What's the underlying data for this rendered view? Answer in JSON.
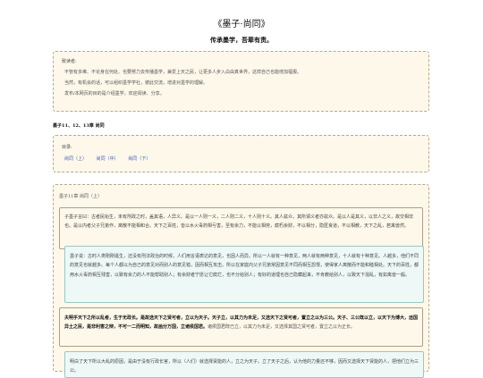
{
  "header": {
    "title": "《墨子·尚同》",
    "motto": "传承墨学，吾辈有责。"
  },
  "intro": {
    "greeting": "致读者:",
    "lines": [
      "不管有多难、不论身在何处、也要努力去传播墨学，兼爱上天之民，让更多人步入白由真世界，这样自己也能增加福报。",
      "当然，有机会的话，可以组织墨学学社，彼此交流，增进对墨学的理解。",
      "发布/本网页的目的是介绍墨学，欢迎阅读、分享。"
    ]
  },
  "section": {
    "heading": "墨子11、12、13章 尚同"
  },
  "toc": {
    "label": "目录:",
    "links": [
      "尚同（上）",
      "尚同（中）",
      "尚同（下）"
    ]
  },
  "chapter": {
    "title": "墨子11章 尚同（上）",
    "quote": "子墨子言曰：古者民始生，未有刑政之时，盖其语，人异义。是以一人则一义，二人则二义，十人则十义。其人兹众，其所谓义者亦兹众。是以人是其义，以非人之义，故交相非也。是以内者父子兄弟作，离散不能相和合。天下之百姓，皆以水火毒药相亏害，至有余力，不能以相劳，腐朽余财，不以相分，隐匿良道，不以相教，天下之乱，若禽兽然。",
    "note": "墨子说：古时人类刚刚诞生，还没有刑法政治的时候，人们用言语表达的意见，也因人而异。所以一人就有一种意见，两人就有两种意见，十人就有十种意见。人越多，他们不同的意见也就越多。每个人都以为自己的意见对而别人的意见错，因而相互攻击。所以在家庭内父子兄弟常因意见不同而相互怨恨，使得家人离散而不能和睦相处。天下的百姓，都用水火毒药相互残害，以致有余力的人不能帮助别人；有余财者宁愿让它腐烂，也不分给别人；有好的道理也自己隐藏起来，不肯教给别人，以致天下混乱，有如禽兽一般。",
    "quote2_bold": "夫明乎天下之所以乱者，生于无政长。是故选天下之贤可者，立以为天子。天子立，以其力为未足，又选天下之贤可者，置立之以为三公。天子、三公既以立，以天下为博大，远国异土之民，是非利害之辩，不可一二而明知，故画分万国，立诸侯国君。",
    "quote2_tail": "诸侯国君既已立，以其力为未足，又选择其国之贤可者，置立之以为正长。",
    "note2": "明白了天下所以大乱的原因，是由于没有行政长官，所以（人们）就选择贤能的人，立之为天子。立了天子之后，认为他的力量还不够，因而又选择天下贤能的人，把他们立为三公。"
  }
}
